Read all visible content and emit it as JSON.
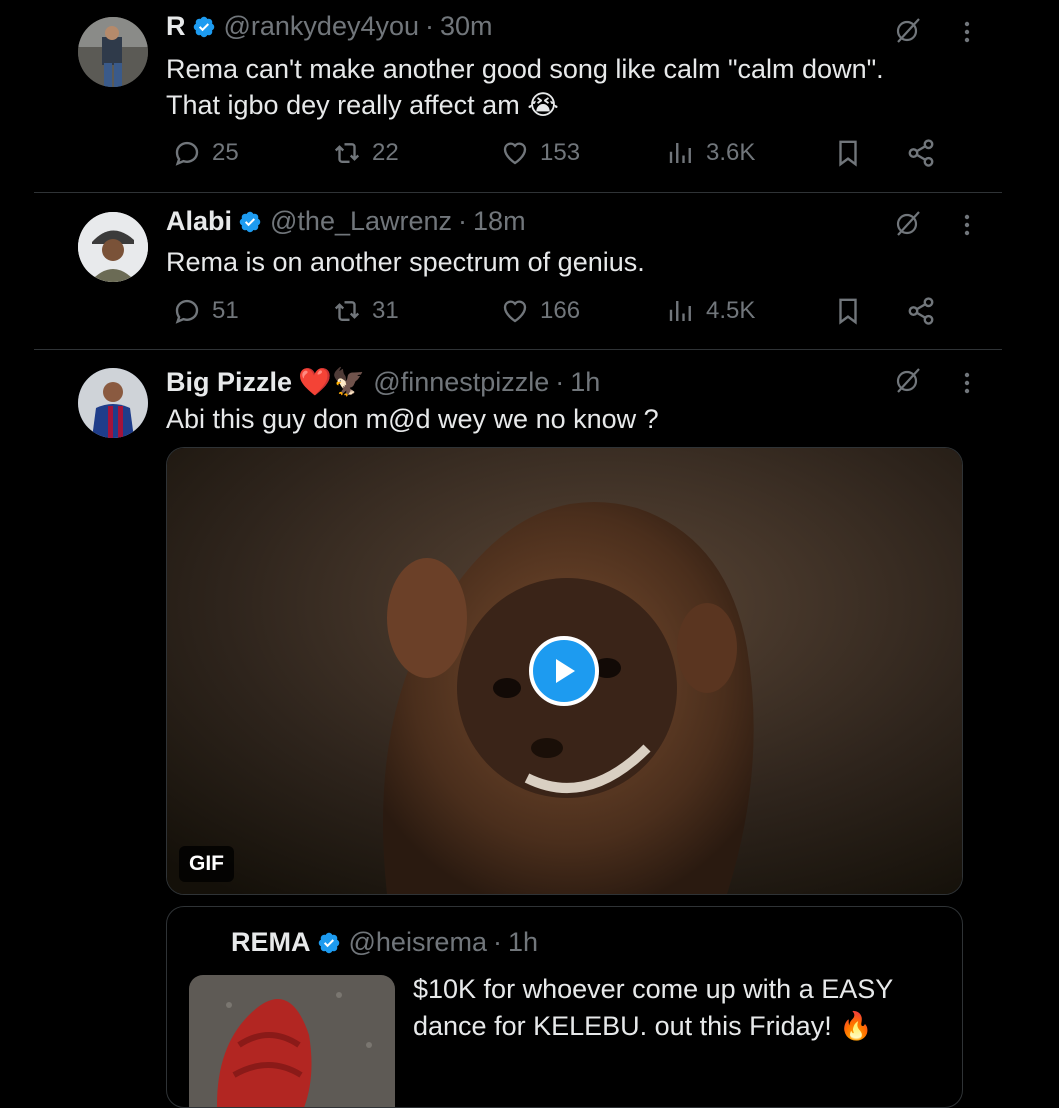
{
  "tweets": [
    {
      "name": "R",
      "handle": "@rankydey4you",
      "time": "30m",
      "text_line1": "Rema can't make another good song like calm \"calm down\".",
      "text_line2": "That igbo dey really affect am",
      "emoji": "😭",
      "replies": "25",
      "reposts": "22",
      "likes": "153",
      "views": "3.6K"
    },
    {
      "name": "Alabi",
      "handle": "@the_Lawrenz",
      "time": "18m",
      "text_line1": "Rema is on another spectrum of genius.",
      "replies": "51",
      "reposts": "31",
      "likes": "166",
      "views": "4.5K"
    },
    {
      "name": "Big Pizzle",
      "name_emoji": "❤️🦅",
      "handle": "@finnestpizzle",
      "time": "1h",
      "text_line1": "Abi this guy don m@d wey we no know ?",
      "media_badge": "GIF"
    }
  ],
  "quote": {
    "name": "REMA",
    "handle": "@heisrema",
    "time": "1h",
    "text_line1": "$10K for whoever come up with a EASY",
    "text_line2": "dance for KELEBU. out this Friday!",
    "emoji": "🔥"
  },
  "colors": {
    "bg": "#000000",
    "text": "#e7e9ea",
    "muted": "#71767b",
    "accent": "#1d9bf0",
    "divider": "#2f3336"
  },
  "icons": [
    "verified-badge-icon",
    "grok-icon",
    "more-icon",
    "reply-icon",
    "repost-icon",
    "like-icon",
    "views-icon",
    "bookmark-icon",
    "share-icon",
    "play-icon"
  ]
}
